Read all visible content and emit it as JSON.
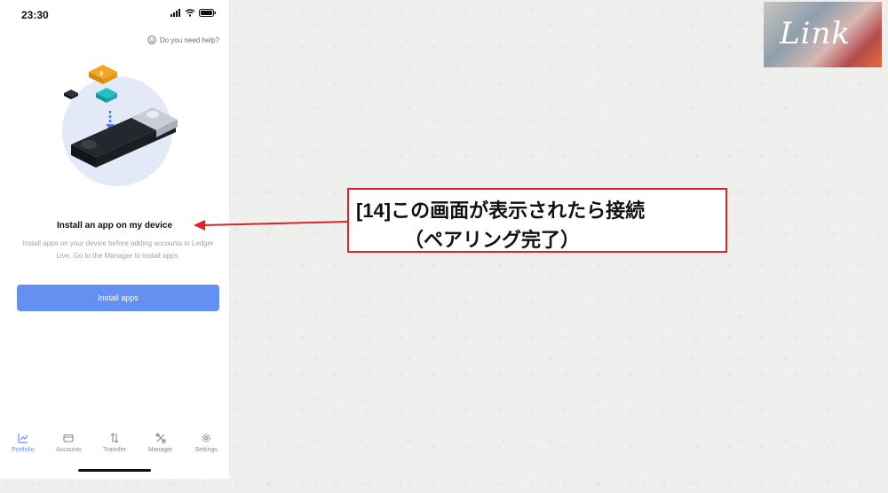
{
  "status_bar": {
    "time": "23:30"
  },
  "help": {
    "label": "Do you need help?"
  },
  "empty_state": {
    "title": "Install an app on my device",
    "description": "Install apps on your device before adding accounts in Ledger Live. Go to the Manager to install apps.",
    "button_label": "Install apps"
  },
  "tabs": [
    {
      "label": "Portfolio",
      "icon": "chart-line-icon",
      "active": true
    },
    {
      "label": "Accounts",
      "icon": "wallet-icon",
      "active": false
    },
    {
      "label": "Transfer",
      "icon": "arrows-transfer-icon",
      "active": false
    },
    {
      "label": "Manager",
      "icon": "tools-icon",
      "active": false
    },
    {
      "label": "Settings",
      "icon": "gear-icon",
      "active": false
    }
  ],
  "annotation": {
    "line1": "[14]この画面が表示されたら接続",
    "line2": "（ペアリング完了）"
  },
  "logo": {
    "text": "Link"
  },
  "colors": {
    "accent": "#6490f1",
    "callout_border": "#d9232d"
  }
}
